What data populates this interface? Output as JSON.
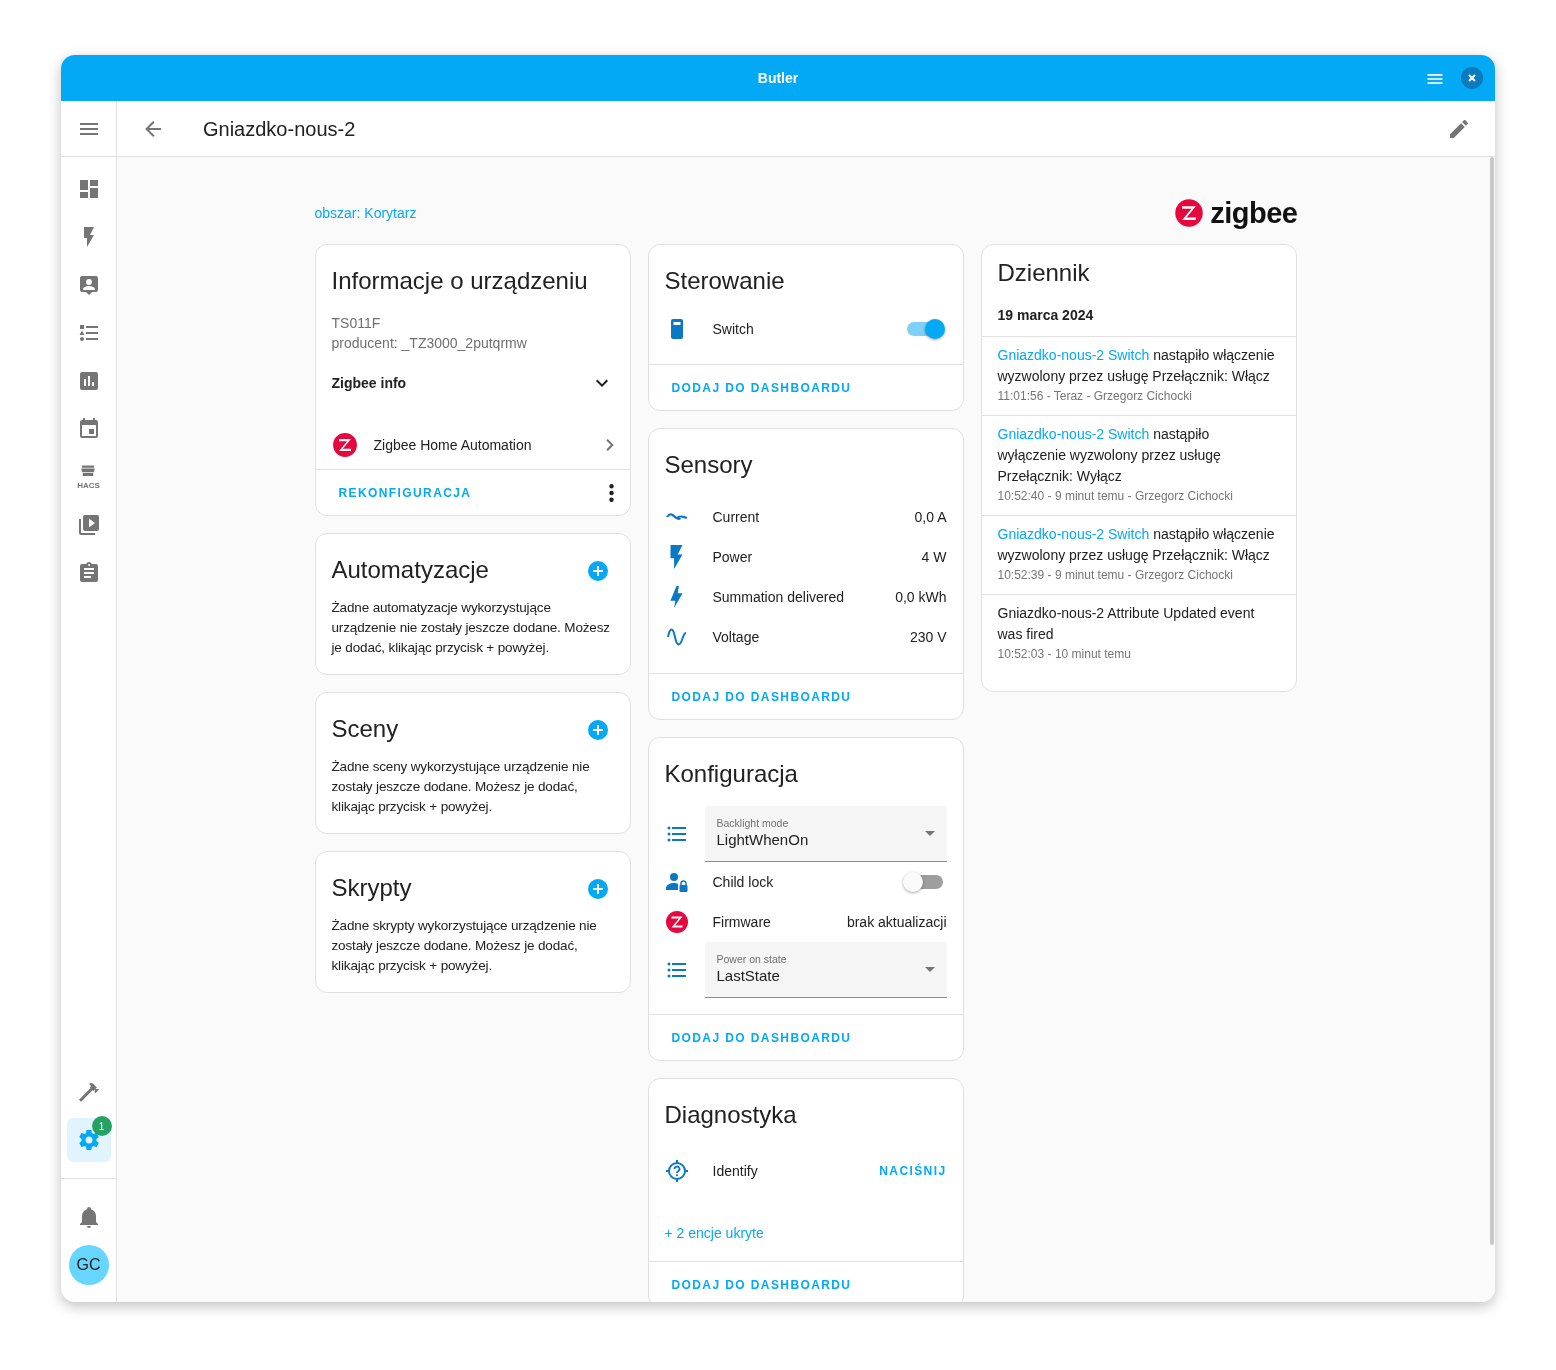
{
  "window": {
    "title": "Butler"
  },
  "toolbar": {
    "title": "Gniazdko-nous-2"
  },
  "sidebar": {
    "items": [
      {
        "selected": false
      },
      {
        "selected": false
      },
      {
        "selected": false
      },
      {
        "selected": false
      },
      {
        "selected": false
      },
      {
        "selected": false
      },
      {
        "selected": false,
        "label": "HACS"
      },
      {
        "selected": false
      },
      {
        "selected": false
      }
    ],
    "bottom_items": [
      {
        "selected": false
      },
      {
        "selected": true,
        "badge": "1"
      }
    ],
    "avatar": "GC"
  },
  "area_link": "obszar: Korytarz",
  "brand_logo": "zigbee",
  "device_info": {
    "title": "Informacje o urządzeniu",
    "model": "TS011F",
    "manufacturer": "producent: _TZ3000_2putqrmw",
    "section": {
      "label": "Zigbee info",
      "expanded": false
    },
    "integration": "Zigbee Home Automation",
    "action": "REKONFIGURACJA"
  },
  "related": [
    {
      "title": "Automatyzacje",
      "text": "Żadne automatyzacje wykorzystujące urządzenie nie zostały jeszcze dodane. Możesz je dodać, klikając przycisk + powyżej."
    },
    {
      "title": "Sceny",
      "text": "Żadne sceny wykorzystujące urządzenie nie zostały jeszcze dodane. Możesz je dodać, klikając przycisk + powyżej."
    },
    {
      "title": "Skrypty",
      "text": "Żadne skrypty wykorzystujące urządzenie nie zostały jeszcze dodane. Możesz je dodać, klikając przycisk + powyżej."
    }
  ],
  "controls": {
    "title": "Sterowanie",
    "entities": [
      {
        "name": "Switch",
        "on": true
      }
    ],
    "action": "DODAJ DO DASHBOARDU"
  },
  "sensors": {
    "title": "Sensory",
    "entities": [
      {
        "name": "Current",
        "value": "0,0 A"
      },
      {
        "name": "Power",
        "value": "4 W"
      },
      {
        "name": "Summation delivered",
        "value": "0,0 kWh"
      },
      {
        "name": "Voltage",
        "value": "230 V"
      }
    ],
    "action": "DODAJ DO DASHBOARDU"
  },
  "configuration": {
    "title": "Konfiguracja",
    "entities": [
      {
        "kind": "select",
        "label": "Backlight mode",
        "value": "LightWhenOn"
      },
      {
        "kind": "toggle",
        "name": "Child lock",
        "on": false
      },
      {
        "kind": "text",
        "name": "Firmware",
        "value": "brak aktualizacji"
      },
      {
        "kind": "select",
        "label": "Power on state",
        "value": "LastState"
      }
    ],
    "action": "DODAJ DO DASHBOARDU"
  },
  "diagnostics": {
    "title": "Diagnostyka",
    "entities": [
      {
        "name": "Identify",
        "button": "NACIŚNIJ"
      }
    ],
    "hidden": "+ 2 encje ukryte",
    "action": "DODAJ DO DASHBOARDU"
  },
  "logbook": {
    "title": "Dziennik",
    "date": "19 marca 2024",
    "entries": [
      {
        "entity": "Gniazdko-nous-2 Switch",
        "message": "nastąpiło włączenie wyzwolony przez usługę Przełącznik: Włącz",
        "meta": "11:01:56 - Teraz - Grzegorz Cichocki"
      },
      {
        "entity": "Gniazdko-nous-2 Switch",
        "message": "nastąpiło wyłączenie wyzwolony przez usługę Przełącznik: Wyłącz",
        "meta": "10:52:40 - 9 minut temu - Grzegorz Cichocki"
      },
      {
        "entity": "Gniazdko-nous-2 Switch",
        "message": "nastąpiło włączenie wyzwolony przez usługę Przełącznik: Włącz",
        "meta": "10:52:39 - 9 minut temu - Grzegorz Cichocki"
      },
      {
        "message": "Gniazdko-nous-2 Attribute Updated event was fired",
        "meta": "10:52:03 - 10 minut temu"
      }
    ]
  }
}
